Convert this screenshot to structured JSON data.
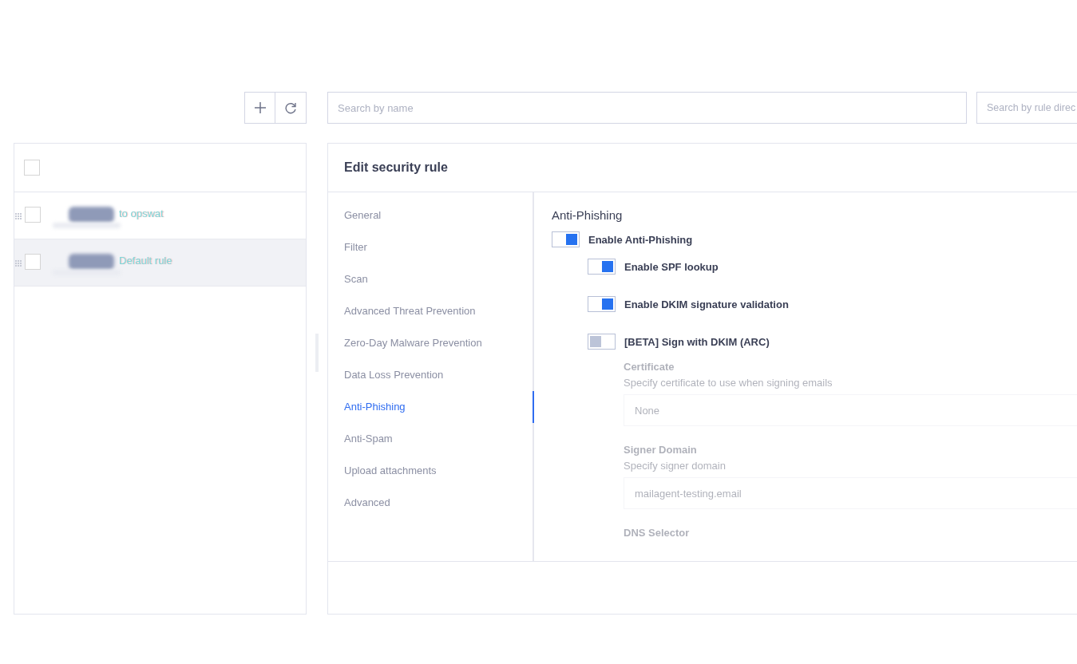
{
  "toolbar": {
    "buttons": [
      {
        "kind": "add"
      },
      {
        "kind": "refresh"
      }
    ]
  },
  "search": [
    {
      "placeholder": "Search by name"
    },
    {
      "placeholder": "Search by rule direc"
    }
  ],
  "rule_list": {
    "header_checked": false,
    "rows": [
      {
        "name": "to opswat",
        "checked": false,
        "selected": false
      },
      {
        "name": "Default rule",
        "checked": false,
        "selected": true
      }
    ]
  },
  "editor": {
    "title": "Edit security rule",
    "nav": [
      {
        "label": "General",
        "selected": false
      },
      {
        "label": "Filter",
        "selected": false
      },
      {
        "label": "Scan",
        "selected": false
      },
      {
        "label": "Advanced Threat Prevention",
        "selected": false
      },
      {
        "label": "Zero-Day Malware Prevention",
        "selected": false
      },
      {
        "label": "Data Loss Prevention",
        "selected": false
      },
      {
        "label": "Anti-Phishing",
        "selected": true
      },
      {
        "label": "Anti-Spam",
        "selected": false
      },
      {
        "label": "Upload attachments",
        "selected": false
      },
      {
        "label": "Advanced",
        "selected": false
      }
    ],
    "section_title": "Anti-Phishing",
    "toggles": [
      {
        "label": "Enable Anti-Phishing",
        "on": true,
        "children": [
          {
            "label": "Enable SPF lookup",
            "on": true
          },
          {
            "label": "Enable DKIM signature validation",
            "on": true
          },
          {
            "label": "[BETA] Sign with DKIM (ARC)",
            "on": false,
            "fields": [
              {
                "label": "Certificate",
                "hint": "Specify certificate to use when signing emails",
                "value": "None",
                "disabled": true
              },
              {
                "label": "Signer Domain",
                "hint": "Specify signer domain",
                "value": "mailagent-testing.email",
                "disabled": true
              },
              {
                "label": "DNS Selector",
                "disabled": true
              }
            ]
          }
        ]
      }
    ]
  }
}
